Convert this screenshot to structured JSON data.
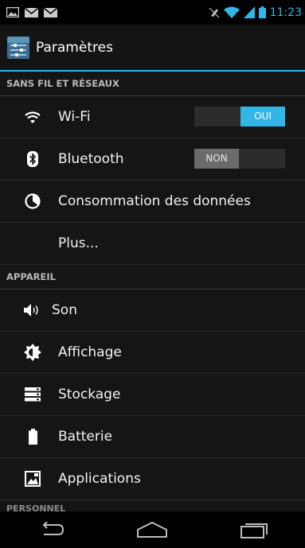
{
  "status_bar": {
    "time": "11:23",
    "left_icons": [
      "image-notification-icon",
      "mail-icon",
      "mail-icon"
    ],
    "right_icons": [
      "mute-icon",
      "wifi-signal-icon",
      "cell-signal-icon",
      "battery-icon"
    ]
  },
  "action_bar": {
    "title": "Paramètres",
    "icon": "settings-app-icon"
  },
  "sections": {
    "wireless": {
      "header": "SANS FIL ET RÉSEAUX",
      "wifi": {
        "label": "Wi-Fi",
        "toggle": "OUI",
        "state": "on"
      },
      "bluetooth": {
        "label": "Bluetooth",
        "toggle": "NON",
        "state": "off"
      },
      "data_usage": {
        "label": "Consommation des données"
      },
      "more": {
        "label": "Plus..."
      }
    },
    "device": {
      "header": "APPAREIL",
      "sound": {
        "label": "Son"
      },
      "display": {
        "label": "Affichage"
      },
      "storage": {
        "label": "Stockage"
      },
      "battery": {
        "label": "Batterie"
      },
      "apps": {
        "label": "Applications"
      }
    },
    "personal": {
      "header": "PERSONNEL"
    }
  },
  "colors": {
    "accent": "#33b5e5",
    "background": "#151515",
    "text": "#f2f2f2"
  },
  "nav_bar": {
    "buttons": [
      "back-icon",
      "home-icon",
      "recent-apps-icon"
    ]
  }
}
